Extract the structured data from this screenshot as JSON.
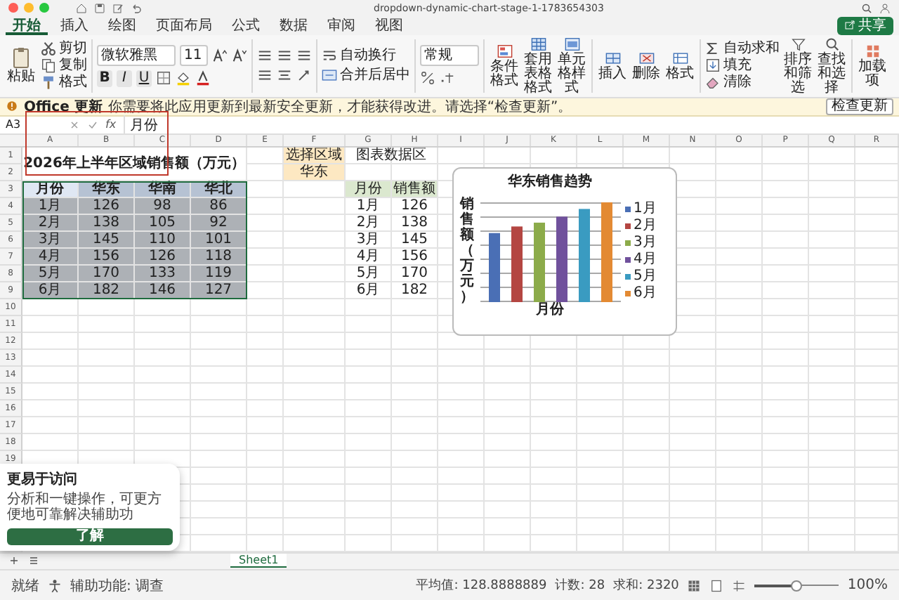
{
  "window": {
    "title": "dropdown-dynamic-chart-stage-1-1783654303"
  },
  "tabs": [
    {
      "label": "开始",
      "selected": true
    },
    {
      "label": "插入",
      "selected": false
    },
    {
      "label": "绘图",
      "selected": false
    },
    {
      "label": "页面布局",
      "selected": false
    },
    {
      "label": "公式",
      "selected": false
    },
    {
      "label": "数据",
      "selected": false
    },
    {
      "label": "审阅",
      "selected": false
    },
    {
      "label": "视图",
      "selected": false
    }
  ],
  "share_button": "共享",
  "ribbon": {
    "clipboard": {
      "paste": "粘贴",
      "items": [
        "剪切",
        "复制",
        "格式"
      ]
    },
    "font": {
      "name": "微软雅黑",
      "size": "11",
      "styles": [
        "B",
        "I",
        "U"
      ]
    },
    "wrap": [
      "自动换行",
      "合并后居中"
    ],
    "number_format": "常规",
    "styles": [
      "条件格式",
      "套用表格格式",
      "单元格样式"
    ],
    "cells": [
      "插入",
      "删除",
      "格式"
    ],
    "editing": [
      "自动求和",
      "填充",
      "清除"
    ],
    "sort_find": [
      "排序和筛选",
      "查找和选择"
    ],
    "addins": "加载项"
  },
  "info_bar": {
    "label": "Office 更新",
    "message": "你需要将此应用更新到最新安全更新，才能获得改进。请选择“检查更新”。",
    "button": "检查更新"
  },
  "formula_bar": {
    "cell": "A3",
    "function_label": "fx",
    "value": "月份"
  },
  "columns": [
    "A",
    "B",
    "C",
    "D",
    "E",
    "F",
    "G",
    "H",
    "I",
    "J",
    "K",
    "L",
    "M",
    "N",
    "O",
    "P",
    "Q",
    "R"
  ],
  "rows": [
    "1",
    "2",
    "3",
    "4",
    "5",
    "6",
    "7",
    "8",
    "9",
    "10",
    "11",
    "12",
    "13",
    "14",
    "15",
    "16",
    "17",
    "18",
    "19"
  ],
  "sheet": {
    "title_cell": "2026年上半年区域销售额（万元）",
    "selector": {
      "label": "选择区域",
      "value": "华东"
    },
    "chart_area_label": "图表数据区",
    "table": {
      "columns": [
        "月份",
        "华东",
        "华南",
        "华北"
      ],
      "rows": [
        [
          "1月",
          "126",
          "98",
          "86"
        ],
        [
          "2月",
          "138",
          "105",
          "92"
        ],
        [
          "3月",
          "145",
          "110",
          "101"
        ],
        [
          "4月",
          "156",
          "126",
          "118"
        ],
        [
          "5月",
          "170",
          "133",
          "119"
        ],
        [
          "6月",
          "182",
          "146",
          "127"
        ]
      ]
    },
    "chart_table": {
      "columns": [
        "月份",
        "销售额"
      ],
      "rows": [
        [
          "1月",
          "126"
        ],
        [
          "2月",
          "138"
        ],
        [
          "3月",
          "145"
        ],
        [
          "4月",
          "156"
        ],
        [
          "5月",
          "170"
        ],
        [
          "6月",
          "182"
        ]
      ]
    }
  },
  "chart": {
    "title": "华东销售趋势",
    "ylabel": "销售额（万元）",
    "xlabel": "月份",
    "legend": [
      {
        "label": "1月",
        "color": "#4a6fb5"
      },
      {
        "label": "2月",
        "color": "#b44642"
      },
      {
        "label": "3月",
        "color": "#8cab4a"
      },
      {
        "label": "4月",
        "color": "#70519c"
      },
      {
        "label": "5月",
        "color": "#3a9bc1"
      },
      {
        "label": "6月",
        "color": "#e38a33"
      }
    ]
  },
  "popup": {
    "title": "更易于访问",
    "text": "分析和一键操作，可更方便地可靠解决辅助功",
    "button": "了解"
  },
  "sheet_tab": "Sheet1",
  "status_bar": {
    "left": [
      "就绪",
      "辅助功能: 调查"
    ],
    "stats": [
      "平均值: 128.8888889",
      "计数: 28",
      "求和: 2320"
    ],
    "zoom_slider": {
      "level": 0.5
    },
    "zoom": "100%"
  }
}
